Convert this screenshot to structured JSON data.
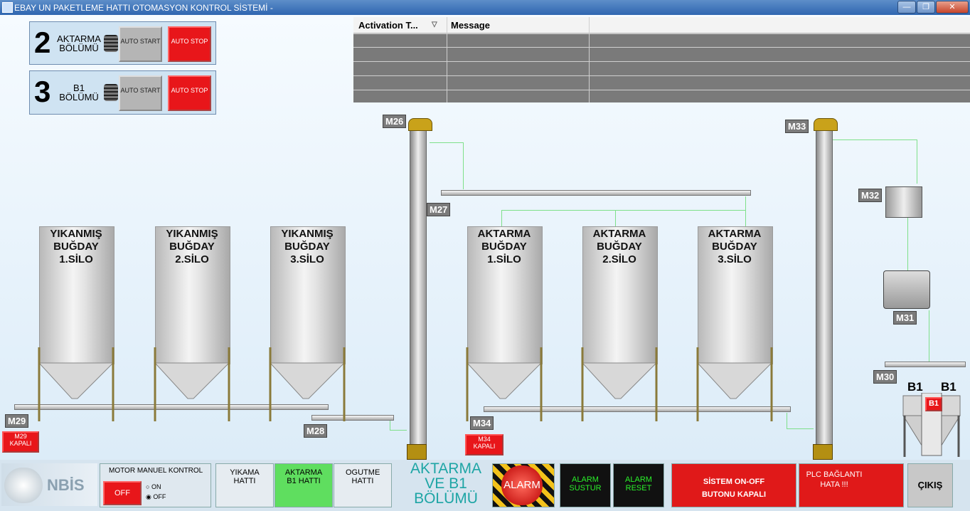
{
  "window": {
    "title": "EBAY UN PAKETLEME HATTI OTOMASYON KONTROL SİSTEMİ -",
    "minimize": "—",
    "restore": "❐",
    "close": "✕"
  },
  "sections": [
    {
      "number": "2",
      "label": "AKTARMA BÖLÜMÜ",
      "start": "AUTO START",
      "stop": "AUTO STOP"
    },
    {
      "number": "3",
      "label": "B1 BÖLÜMÜ",
      "start": "AUTO START",
      "stop": "AUTO STOP"
    }
  ],
  "alarm_table": {
    "columns": [
      "Activation T...",
      "Message"
    ],
    "rows": 5
  },
  "silos": [
    {
      "line1": "YIKANMIŞ",
      "line2": "BUĞDAY",
      "line3": "1.SİLO"
    },
    {
      "line1": "YIKANMIŞ",
      "line2": "BUĞDAY",
      "line3": "2.SİLO"
    },
    {
      "line1": "YIKANMIŞ",
      "line2": "BUĞDAY",
      "line3": "3.SİLO"
    },
    {
      "line1": "AKTARMA",
      "line2": "BUĞDAY",
      "line3": "1.SİLO"
    },
    {
      "line1": "AKTARMA",
      "line2": "BUĞDAY",
      "line3": "2.SİLO"
    },
    {
      "line1": "AKTARMA",
      "line2": "BUĞDAY",
      "line3": "3.SİLO"
    }
  ],
  "motors": {
    "m26": "M26",
    "m27": "M27",
    "m28": "M28",
    "m29": "M29",
    "m30": "M30",
    "m31": "M31",
    "m32": "M32",
    "m33": "M33",
    "m34": "M34"
  },
  "status_tags": {
    "m29": "M29 KAPALI",
    "m34": "M34 KAPALI"
  },
  "b1": {
    "left": "B1",
    "right": "B1",
    "tag": "B1"
  },
  "bottom": {
    "brand": "NBİS",
    "motor_manual": {
      "title": "MOTOR MANUEL KONTROL",
      "off_button": "OFF",
      "on": "ON",
      "off": "OFF"
    },
    "lines": [
      {
        "label": "YIKAMA HATTI"
      },
      {
        "label": "AKTARMA B1 HATTI"
      },
      {
        "label": "OGUTME HATTI"
      }
    ],
    "section_title": "AKTARMA VE B1 BÖLÜMÜ",
    "alarm": "ALARM",
    "alarm_silence": "ALARM SUSTUR",
    "alarm_reset": "ALARM RESET",
    "system": "SİSTEM ON-OFF BUTONU KAPALI",
    "plc": "PLC BAĞLANTI HATA !!!",
    "exit": "ÇIKIŞ"
  }
}
